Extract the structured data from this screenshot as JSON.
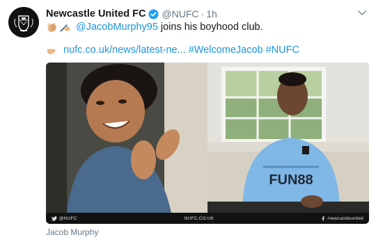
{
  "tweet": {
    "author_name": "Newcastle United FC",
    "handle": "@NUFC",
    "separator": "·",
    "time": "1h",
    "mention": "@JacobMurphy95",
    "text": "joins his boyhood club.",
    "link": "nufc.co.uk/news/latest-ne...",
    "hashtags": [
      "#WelcomeJacob",
      "#NUFC"
    ],
    "icons": {
      "verified": "verified-badge-icon",
      "caret": "chevron-down-icon",
      "emoji_line1": [
        "clapping-hands-icon",
        "writing-hand-icon"
      ],
      "emoji_line2": [
        "pointing-hand-icon"
      ]
    }
  },
  "media": {
    "footer_left": "@NUFC",
    "footer_center": "NUFC.CO.UK",
    "footer_right": "/newcastleunited",
    "sponsor_text": "FUN88",
    "caption": "Jacob Murphy"
  },
  "colors": {
    "link": "#1b95e0",
    "muted": "#657786",
    "text": "#14171a",
    "kit_blue": "#7fb8e6"
  }
}
